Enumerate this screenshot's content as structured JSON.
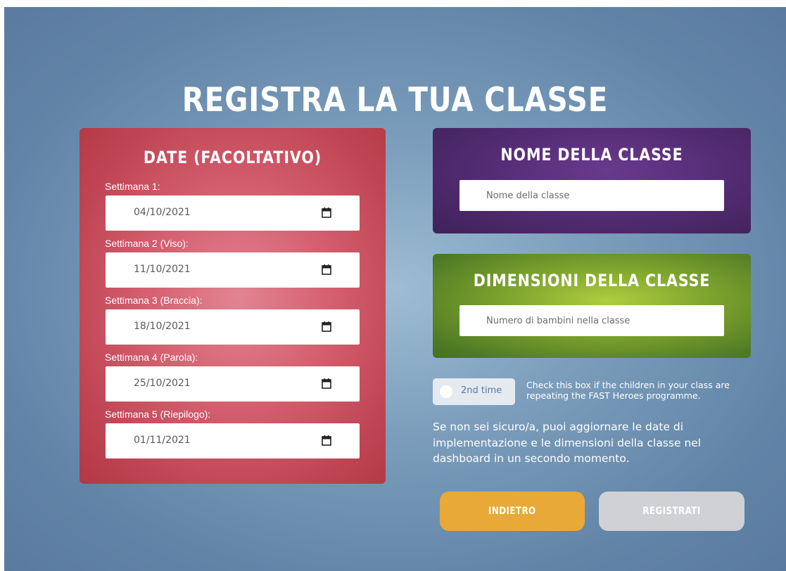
{
  "page": {
    "title": "REGISTRA LA TUA CLASSE"
  },
  "dates_panel": {
    "heading": "DATE (FACOLTATIVO)",
    "weeks": [
      {
        "label": "Settimana 1:",
        "value": "04/10/2021"
      },
      {
        "label": "Settimana 2 (Viso):",
        "value": "11/10/2021"
      },
      {
        "label": "Settimana 3 (Braccia):",
        "value": "18/10/2021"
      },
      {
        "label": "Settimana 4 (Parola):",
        "value": "25/10/2021"
      },
      {
        "label": "Settimana 5 (Riepilogo):",
        "value": "01/11/2021"
      }
    ],
    "icon": "calendar-icon"
  },
  "name_panel": {
    "heading": "NOME DELLA CLASSE",
    "placeholder": "Nome della classe",
    "value": ""
  },
  "size_panel": {
    "heading": "DIMENSIONI DELLA CLASSE",
    "placeholder": "Numero di bambini nella classe",
    "value": ""
  },
  "second_time": {
    "label": "2nd time",
    "checked": false,
    "help_text": "Check this box if the children in your class are repeating the FAST Heroes programme."
  },
  "note": "Se non sei sicuro/a, puoi aggiornare le date di implementazione e le dimensioni della classe nel dashboard in un secondo momento.",
  "buttons": {
    "back_label": "INDIETRO",
    "register_label": "REGISTRATI"
  },
  "colors": {
    "dates_panel": "#c9505f",
    "name_panel": "#4e2a6e",
    "size_panel": "#7fa52e",
    "back_button": "#e9a936",
    "register_button_disabled": "#cfd1d4",
    "background": "#7393b3"
  }
}
